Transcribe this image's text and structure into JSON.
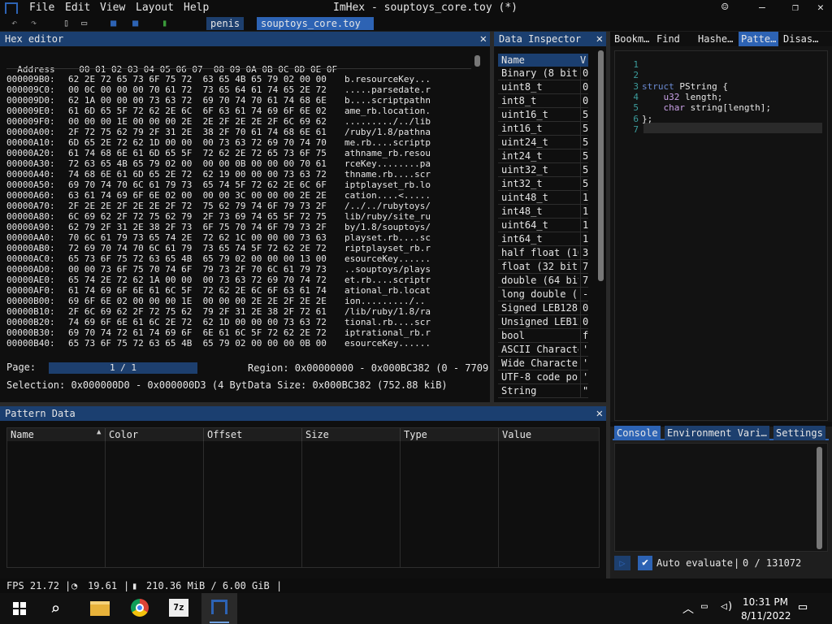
{
  "window": {
    "title": "ImHex - souptoys_core.toy (*)"
  },
  "menu": [
    "File",
    "Edit",
    "View",
    "Layout",
    "Help"
  ],
  "doc_tabs": [
    "penis",
    "souptoys_core.toy"
  ],
  "hex_editor": {
    "title": "Hex editor",
    "address_label": "Address",
    "columns": "00 01 02 03 04 05 06 07  08 09 0A 0B 0C 0D 0E 0F",
    "rows": [
      {
        "addr": "000009B0:",
        "bytes": "62 2E 72 65 73 6F 75 72  63 65 4B 65 79 02 00 00",
        "ascii": "b.resourceKey..."
      },
      {
        "addr": "000009C0:",
        "bytes": "00 0C 00 00 00 70 61 72  73 65 64 61 74 65 2E 72",
        "ascii": ".....parsedate.r"
      },
      {
        "addr": "000009D0:",
        "bytes": "62 1A 00 00 00 73 63 72  69 70 74 70 61 74 68 6E",
        "ascii": "b....scriptpathn"
      },
      {
        "addr": "000009E0:",
        "bytes": "61 6D 65 5F 72 62 2E 6C  6F 63 61 74 69 6F 6E 02",
        "ascii": "ame_rb.location."
      },
      {
        "addr": "000009F0:",
        "bytes": "00 00 00 1E 00 00 00 2E  2E 2F 2E 2E 2F 6C 69 62",
        "ascii": "........./../lib"
      },
      {
        "addr": "00000A00:",
        "bytes": "2F 72 75 62 79 2F 31 2E  38 2F 70 61 74 68 6E 61",
        "ascii": "/ruby/1.8/pathna"
      },
      {
        "addr": "00000A10:",
        "bytes": "6D 65 2E 72 62 1D 00 00  00 73 63 72 69 70 74 70",
        "ascii": "me.rb....scriptp"
      },
      {
        "addr": "00000A20:",
        "bytes": "61 74 68 6E 61 6D 65 5F  72 62 2E 72 65 73 6F 75",
        "ascii": "athname_rb.resou"
      },
      {
        "addr": "00000A30:",
        "bytes": "72 63 65 4B 65 79 02 00  00 00 0B 00 00 00 70 61",
        "ascii": "rceKey........pa"
      },
      {
        "addr": "00000A40:",
        "bytes": "74 68 6E 61 6D 65 2E 72  62 19 00 00 00 73 63 72",
        "ascii": "thname.rb....scr"
      },
      {
        "addr": "00000A50:",
        "bytes": "69 70 74 70 6C 61 79 73  65 74 5F 72 62 2E 6C 6F",
        "ascii": "iptplayset_rb.lo"
      },
      {
        "addr": "00000A60:",
        "bytes": "63 61 74 69 6F 6E 02 00  00 00 3C 00 00 00 2E 2E",
        "ascii": "cation....<....."
      },
      {
        "addr": "00000A70:",
        "bytes": "2F 2E 2E 2F 2E 2E 2F 72  75 62 79 74 6F 79 73 2F",
        "ascii": "/../../rubytoys/"
      },
      {
        "addr": "00000A80:",
        "bytes": "6C 69 62 2F 72 75 62 79  2F 73 69 74 65 5F 72 75",
        "ascii": "lib/ruby/site_ru"
      },
      {
        "addr": "00000A90:",
        "bytes": "62 79 2F 31 2E 38 2F 73  6F 75 70 74 6F 79 73 2F",
        "ascii": "by/1.8/souptoys/"
      },
      {
        "addr": "00000AA0:",
        "bytes": "70 6C 61 79 73 65 74 2E  72 62 1C 00 00 00 73 63",
        "ascii": "playset.rb....sc"
      },
      {
        "addr": "00000AB0:",
        "bytes": "72 69 70 74 70 6C 61 79  73 65 74 5F 72 62 2E 72",
        "ascii": "riptplayset_rb.r"
      },
      {
        "addr": "00000AC0:",
        "bytes": "65 73 6F 75 72 63 65 4B  65 79 02 00 00 00 13 00",
        "ascii": "esourceKey......"
      },
      {
        "addr": "00000AD0:",
        "bytes": "00 00 73 6F 75 70 74 6F  79 73 2F 70 6C 61 79 73",
        "ascii": "..souptoys/plays"
      },
      {
        "addr": "00000AE0:",
        "bytes": "65 74 2E 72 62 1A 00 00  00 73 63 72 69 70 74 72",
        "ascii": "et.rb....scriptr"
      },
      {
        "addr": "00000AF0:",
        "bytes": "61 74 69 6F 6E 61 6C 5F  72 62 2E 6C 6F 63 61 74",
        "ascii": "ational_rb.locat"
      },
      {
        "addr": "00000B00:",
        "bytes": "69 6F 6E 02 00 00 00 1E  00 00 00 2E 2E 2F 2E 2E",
        "ascii": "ion........./.."
      },
      {
        "addr": "00000B10:",
        "bytes": "2F 6C 69 62 2F 72 75 62  79 2F 31 2E 38 2F 72 61",
        "ascii": "/lib/ruby/1.8/ra"
      },
      {
        "addr": "00000B20:",
        "bytes": "74 69 6F 6E 61 6C 2E 72  62 1D 00 00 00 73 63 72",
        "ascii": "tional.rb....scr"
      },
      {
        "addr": "00000B30:",
        "bytes": "69 70 74 72 61 74 69 6F  6E 61 6C 5F 72 62 2E 72",
        "ascii": "iptrational_rb.r"
      },
      {
        "addr": "00000B40:",
        "bytes": "65 73 6F 75 72 63 65 4B  65 79 02 00 00 00 0B 00",
        "ascii": "esourceKey......"
      }
    ],
    "page_label": "Page:",
    "page_value": "1 / 1",
    "region": "Region: 0x00000000 - 0x000BC382 (0 - 7709",
    "selection": "Selection: 0x000000D0 - 0x000000D3 (4 Byte",
    "data_size": "Data Size: 0x000BC382 (752.88 kiB)"
  },
  "data_inspector": {
    "title": "Data Inspector",
    "header_name": "Name",
    "header_value": "V",
    "rows": [
      {
        "name": "Binary (8 bit)",
        "value": "0"
      },
      {
        "name": "uint8_t",
        "value": "0"
      },
      {
        "name": "int8_t",
        "value": "0"
      },
      {
        "name": "uint16_t",
        "value": "5"
      },
      {
        "name": "int16_t",
        "value": "5"
      },
      {
        "name": "uint24_t",
        "value": "5"
      },
      {
        "name": "int24_t",
        "value": "5"
      },
      {
        "name": "uint32_t",
        "value": "5"
      },
      {
        "name": "int32_t",
        "value": "5"
      },
      {
        "name": "uint48_t",
        "value": "1"
      },
      {
        "name": "int48_t",
        "value": "1"
      },
      {
        "name": "uint64_t",
        "value": "1"
      },
      {
        "name": "int64_t",
        "value": "1"
      },
      {
        "name": "half float (16",
        "value": "3"
      },
      {
        "name": "float (32 bit)",
        "value": "7"
      },
      {
        "name": "double (64 bit",
        "value": "7"
      },
      {
        "name": "long double (1",
        "value": "-"
      },
      {
        "name": "Signed LEB128",
        "value": "0"
      },
      {
        "name": "Unsigned LEB12",
        "value": "0"
      },
      {
        "name": "bool",
        "value": "f"
      },
      {
        "name": "ASCII Characte",
        "value": "'"
      },
      {
        "name": "Wide Character",
        "value": "'"
      },
      {
        "name": "UTF-8 code poi",
        "value": "'"
      },
      {
        "name": "String",
        "value": "\""
      }
    ]
  },
  "right_tabs": [
    "Bookm…",
    "Find",
    "Hashe…",
    "Patte…",
    "Disas…"
  ],
  "code": {
    "lines": [
      {
        "n": "1",
        "parts": []
      },
      {
        "n": "2",
        "parts": []
      },
      {
        "n": "3",
        "parts": [
          {
            "c": "kw",
            "t": "struct"
          },
          {
            "c": "",
            "t": " PString {"
          }
        ]
      },
      {
        "n": "4",
        "parts": [
          {
            "c": "",
            "t": "    "
          },
          {
            "c": "ty",
            "t": "u32"
          },
          {
            "c": "",
            "t": " length;"
          }
        ]
      },
      {
        "n": "5",
        "parts": [
          {
            "c": "",
            "t": "    "
          },
          {
            "c": "ty",
            "t": "char"
          },
          {
            "c": "",
            "t": " string[length];"
          }
        ]
      },
      {
        "n": "6",
        "parts": [
          {
            "c": "",
            "t": "};"
          }
        ]
      },
      {
        "n": "7",
        "parts": []
      }
    ]
  },
  "console_tabs": [
    "Console",
    "Environment Vari…",
    "Settings"
  ],
  "pattern_controls": {
    "auto_evaluate": "Auto evaluate",
    "counter": "0 / 131072"
  },
  "pattern_data": {
    "title": "Pattern Data",
    "headers": [
      "Name",
      "Color",
      "Offset",
      "Size",
      "Type",
      "Value"
    ]
  },
  "status": {
    "fps": "FPS 21.72",
    "cpu": "19.61",
    "memory": "210.36 MiB / 6.00 GiB"
  },
  "taskbar": {
    "time": "10:31 PM",
    "date": "8/11/2022"
  }
}
